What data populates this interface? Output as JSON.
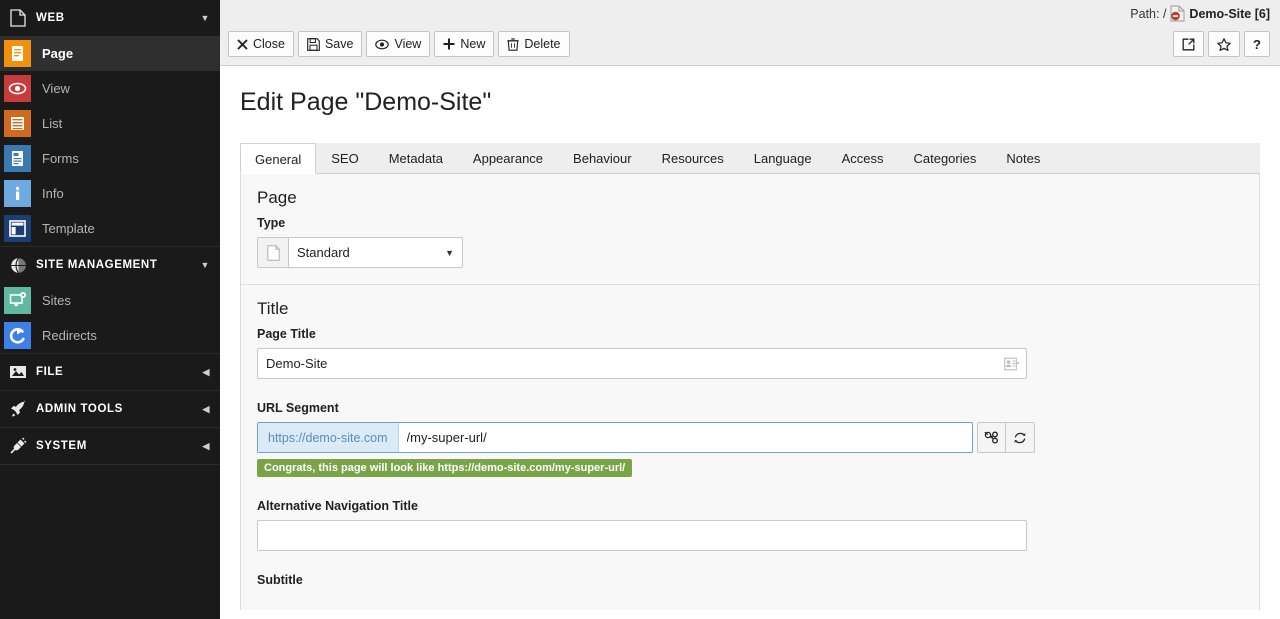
{
  "sidebar": {
    "groups": [
      {
        "label": "WEB",
        "icon": "page-doc-icon",
        "state": "expanded",
        "items": [
          {
            "label": "Page",
            "icon": "page-module-icon",
            "color": "#f2920b",
            "active": true
          },
          {
            "label": "View",
            "icon": "eye-module-icon",
            "color": "#c73c38",
            "active": false
          },
          {
            "label": "List",
            "icon": "list-module-icon",
            "color": "#d2691e",
            "active": false
          },
          {
            "label": "Forms",
            "icon": "forms-module-icon",
            "color": "#3a79b2",
            "active": false
          },
          {
            "label": "Info",
            "icon": "info-module-icon",
            "color": "#6daae0",
            "active": false
          },
          {
            "label": "Template",
            "icon": "template-module-icon",
            "color": "#1c3f73",
            "active": false
          }
        ]
      },
      {
        "label": "SITE MANAGEMENT",
        "icon": "globe-icon",
        "state": "expanded",
        "items": [
          {
            "label": "Sites",
            "icon": "sites-module-icon",
            "color": "#5fb89f",
            "active": false
          },
          {
            "label": "Redirects",
            "icon": "redirects-module-icon",
            "color": "#3e7fe8",
            "active": false
          }
        ]
      },
      {
        "label": "FILE",
        "icon": "image-icon",
        "state": "collapsed",
        "items": []
      },
      {
        "label": "ADMIN TOOLS",
        "icon": "rocket-icon",
        "state": "collapsed",
        "items": []
      },
      {
        "label": "SYSTEM",
        "icon": "plug-icon",
        "state": "collapsed",
        "items": []
      }
    ]
  },
  "topbar": {
    "path_label": "Path: /",
    "path_page": "Demo-Site [6]",
    "path_page_icon": "page-hidden-icon",
    "buttons": [
      {
        "label": "Close",
        "icon": "close-x-icon"
      },
      {
        "label": "Save",
        "icon": "floppy-save-icon"
      },
      {
        "label": "View",
        "icon": "eye-view-icon"
      },
      {
        "label": "New",
        "icon": "plus-new-icon"
      },
      {
        "label": "Delete",
        "icon": "trash-delete-icon"
      }
    ],
    "right_buttons": [
      {
        "label": "",
        "icon": "open-in-new-window-icon"
      },
      {
        "label": "",
        "icon": "star-bookmark-icon"
      },
      {
        "label": "?",
        "icon": "help-question-icon"
      }
    ]
  },
  "main": {
    "heading": "Edit Page \"Demo-Site\"",
    "tabs": [
      {
        "label": "General",
        "active": true
      },
      {
        "label": "SEO",
        "active": false
      },
      {
        "label": "Metadata",
        "active": false
      },
      {
        "label": "Appearance",
        "active": false
      },
      {
        "label": "Behaviour",
        "active": false
      },
      {
        "label": "Resources",
        "active": false
      },
      {
        "label": "Language",
        "active": false
      },
      {
        "label": "Access",
        "active": false
      },
      {
        "label": "Categories",
        "active": false
      },
      {
        "label": "Notes",
        "active": false
      }
    ],
    "sections": {
      "page": {
        "title": "Page",
        "type_label": "Type",
        "type_value": "Standard",
        "type_icon": "page-doc-icon",
        "type_options": [
          "Standard"
        ]
      },
      "title": {
        "title": "Title",
        "page_title_label": "Page Title",
        "page_title_value": "Demo-Site",
        "page_title_placeholder": "",
        "page_title_icon": "record-select-icon",
        "url_segment_label": "URL Segment",
        "url_prefix": "https://demo-site.com",
        "url_value": "/my-super-url/",
        "url_placeholder": "",
        "url_unlink_icon": "link-broken-icon",
        "url_recalculate_icon": "refresh-recalculate-icon",
        "url_success_message": "Congrats, this page will look like https://demo-site.com/my-super-url/",
        "alt_nav_label": "Alternative Navigation Title",
        "alt_nav_value": "",
        "alt_nav_placeholder": "",
        "subtitle_label": "Subtitle"
      }
    }
  },
  "colors": {
    "sidebar_bg": "#1a1a1a",
    "sidebar_active_bg": "#2f2f2f",
    "topbar_bg": "#eeeeee",
    "success_green": "#79a548",
    "focus_blue": "#6ba3d6",
    "prefix_bg": "#dbeaf7"
  }
}
